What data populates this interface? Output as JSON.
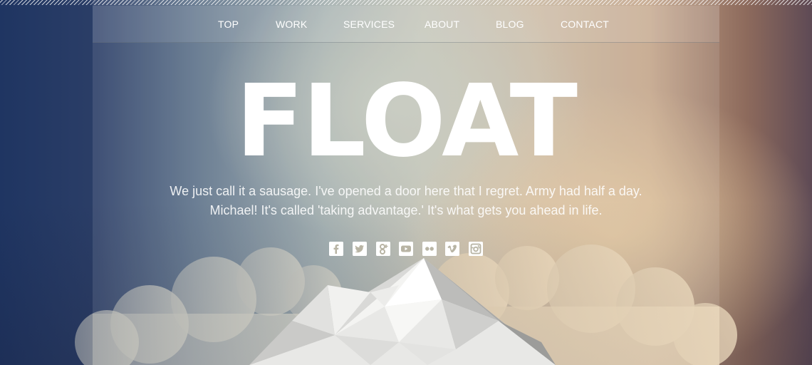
{
  "nav": {
    "items": [
      {
        "label": "TOP"
      },
      {
        "label": "WORK"
      },
      {
        "label": "SERVICES"
      },
      {
        "label": "ABOUT"
      },
      {
        "label": "BLOG"
      },
      {
        "label": "CONTACT"
      }
    ]
  },
  "hero": {
    "title": "FLOAT",
    "tagline_line1": "We just call it a sausage. I've opened a door here that I regret. Army had half a day.",
    "tagline_line2": "Michael! It's called 'taking advantage.' It's what gets you ahead in life."
  },
  "social": [
    {
      "icon": "facebook-icon"
    },
    {
      "icon": "twitter-icon"
    },
    {
      "icon": "google-plus-icon"
    },
    {
      "icon": "youtube-icon"
    },
    {
      "icon": "flickr-icon"
    },
    {
      "icon": "vimeo-icon"
    },
    {
      "icon": "instagram-icon"
    }
  ],
  "colors": {
    "accent": "#ffffff",
    "background_left": "#1f3562",
    "background_center": "#bfbfb2",
    "background_right": "#8d6a5c"
  }
}
